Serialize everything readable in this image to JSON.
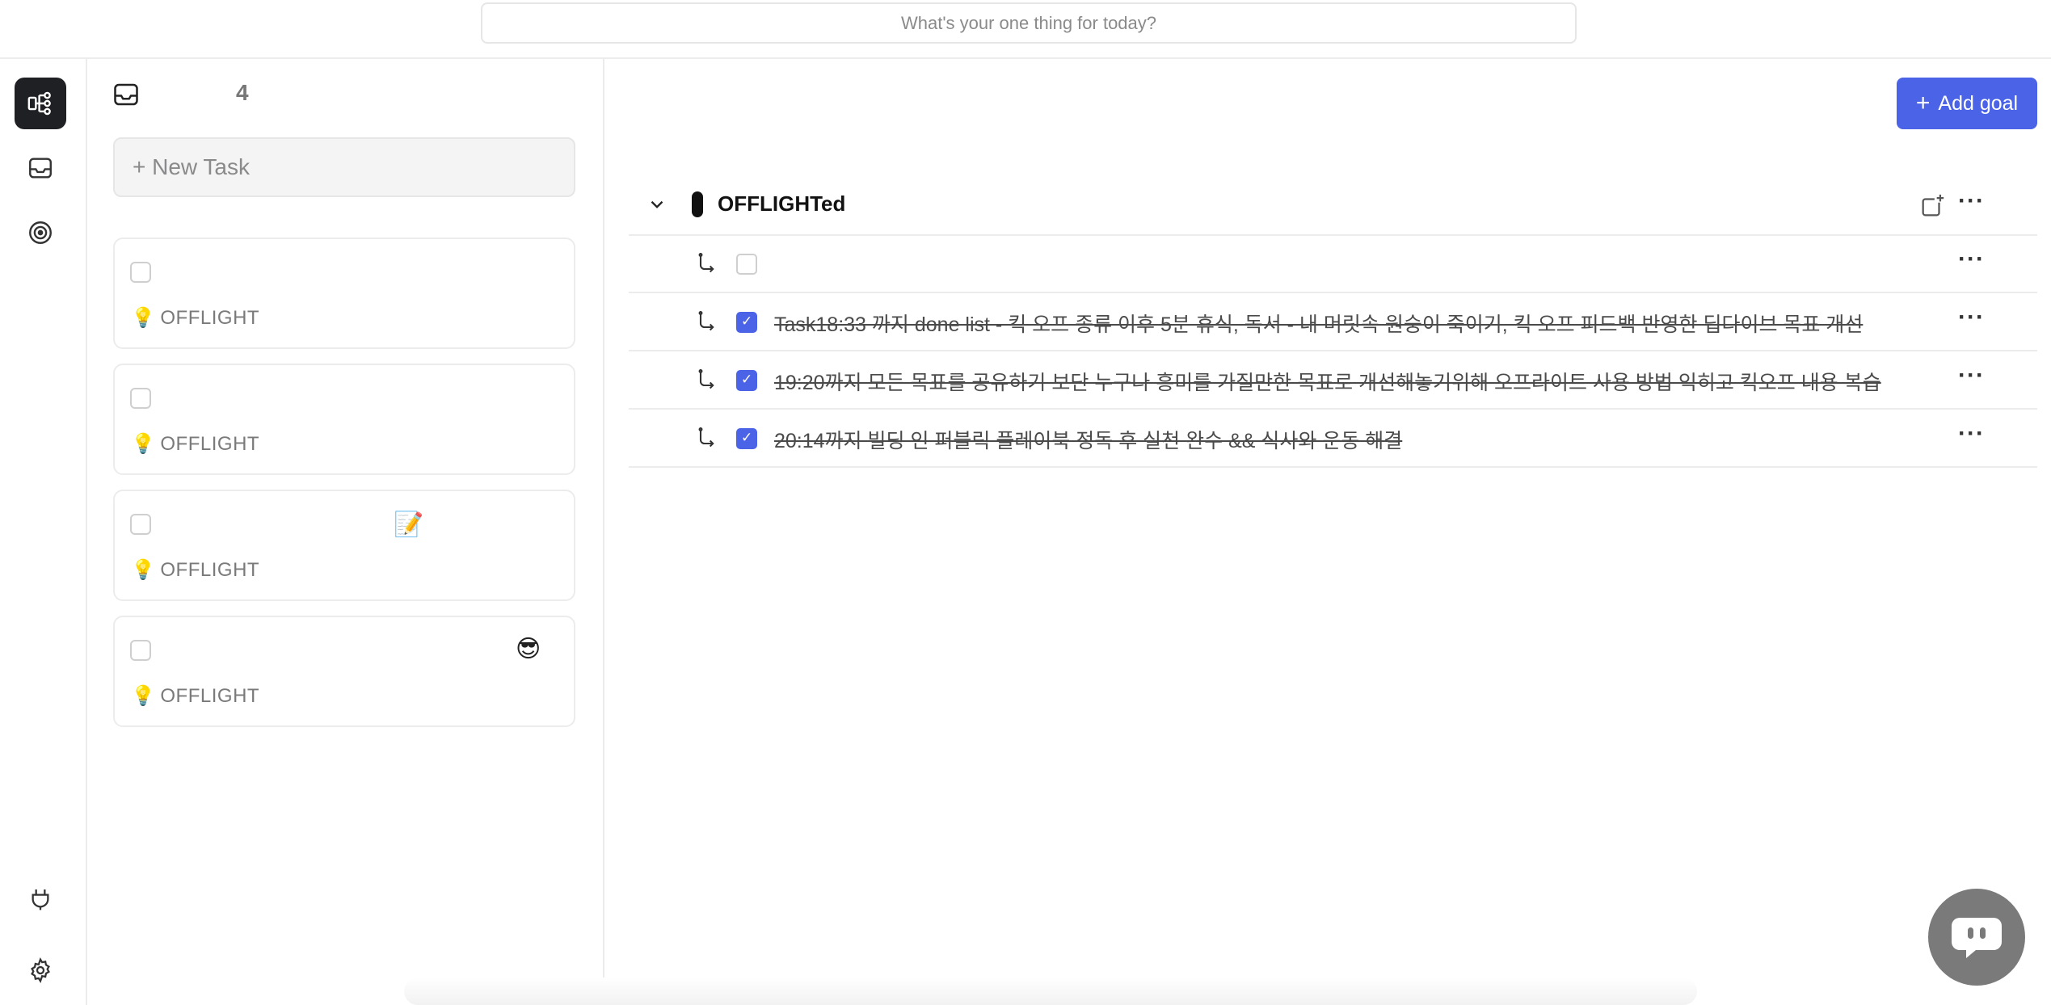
{
  "header": {
    "one_thing_placeholder": "What's your one thing for today?"
  },
  "sidebar": {
    "items": [
      {
        "icon": "goal-tree-icon",
        "active": true
      },
      {
        "icon": "inbox-icon",
        "active": false
      },
      {
        "icon": "target-icon",
        "active": false
      }
    ],
    "bottom": [
      {
        "icon": "plug-icon"
      },
      {
        "icon": "gear-icon"
      }
    ]
  },
  "inbox": {
    "count": "4",
    "new_task_label": "+ New Task",
    "cards": [
      {
        "tag": "OFFLIGHT",
        "emoji": ""
      },
      {
        "tag": "OFFLIGHT",
        "emoji": ""
      },
      {
        "tag": "OFFLIGHT",
        "emoji": "📝"
      },
      {
        "tag": "OFFLIGHT",
        "emoji": "😎"
      }
    ]
  },
  "main": {
    "add_goal_label": "Add goal",
    "goal": {
      "title": "OFFLIGHTed",
      "tasks": [
        {
          "text": "",
          "done": false
        },
        {
          "text": "Task18:33 까지 done list - 킥 오프 종류 이후 5분 휴식, 독서 - 내 머릿속 원숭이 죽이기, 킥 오프 피드백 반영한 딥다이브 목표 개선",
          "done": true
        },
        {
          "text": "19:20까지 모든 목표를 공유하기 보단 누구나 흥미를 가질만한 목표로 개선해놓기위해 오프라이트 사용 방법 익히고 킥오프 내용 복습",
          "done": true
        },
        {
          "text": "20:14까지 빌딩 인 퍼블릭 플레이북 정독 후 실천 완수 && 식사와 운동 해결",
          "done": true
        }
      ]
    }
  },
  "colors": {
    "accent": "#4a63e7",
    "active_rail": "#1f2023"
  }
}
